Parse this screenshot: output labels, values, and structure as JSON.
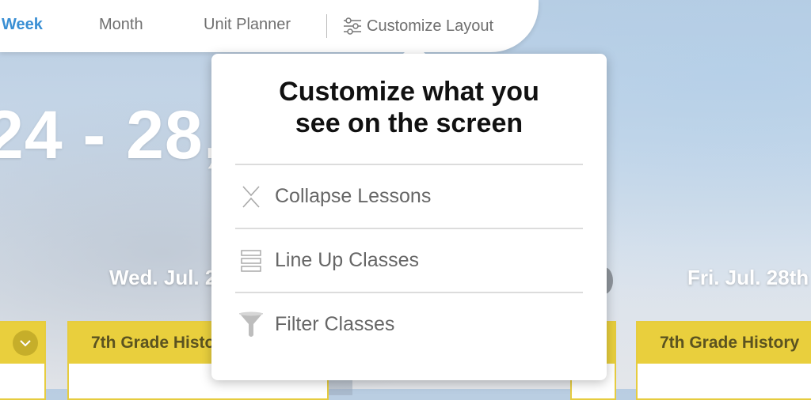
{
  "nav": {
    "week": "Week",
    "month": "Month",
    "unit_planner": "Unit Planner",
    "customize_layout": "Customize Layout"
  },
  "background": {
    "week_range": "24 - 28,",
    "days": [
      "Wed. Jul. 2",
      "Fri. Jul. 28th"
    ],
    "class_cards": [
      "7th Grade Histo",
      "7th Grade History"
    ]
  },
  "popover": {
    "title_line1": "Customize what you",
    "title_line2": "see on the screen",
    "items": [
      {
        "label": "Collapse Lessons",
        "icon": "collapse-icon"
      },
      {
        "label": "Line Up Classes",
        "icon": "line-up-icon"
      },
      {
        "label": "Filter Classes",
        "icon": "filter-icon"
      }
    ]
  },
  "colors": {
    "accent_blue": "#3a8fd4",
    "card_yellow": "#e9cf3d",
    "text_grey": "#666666"
  }
}
